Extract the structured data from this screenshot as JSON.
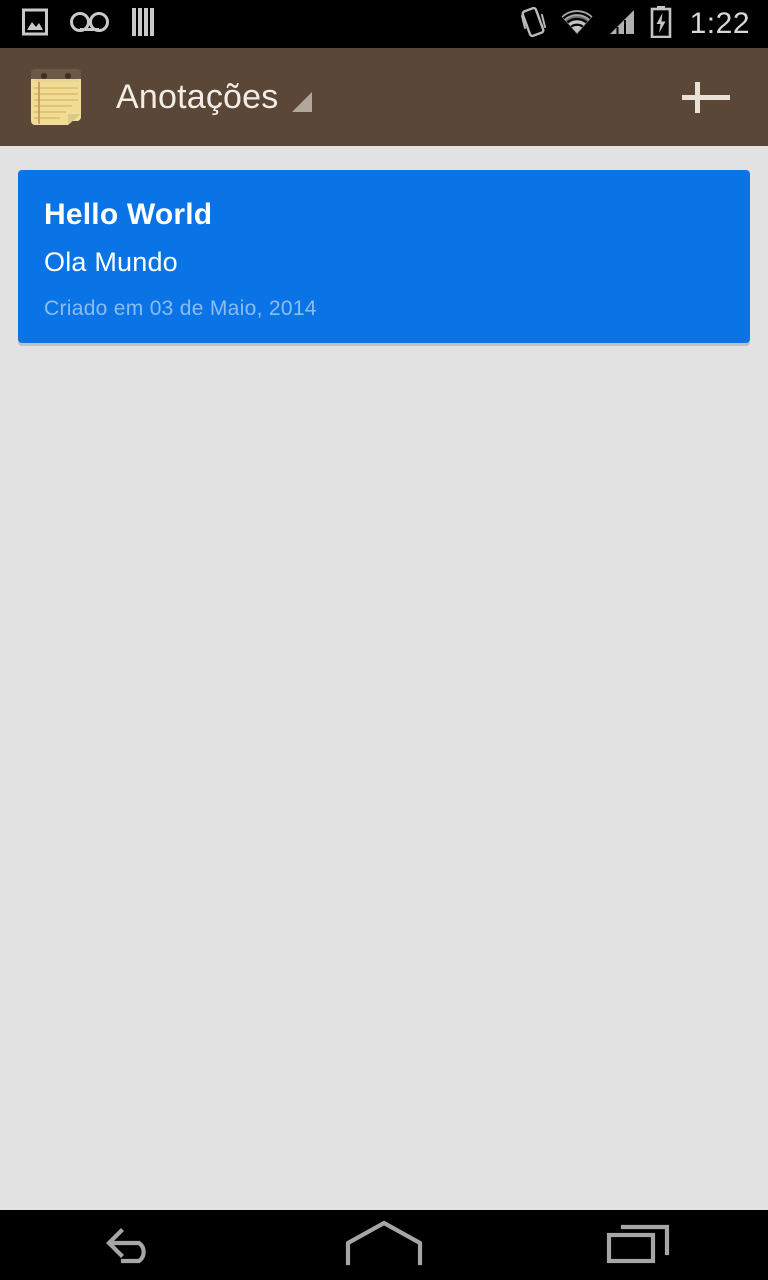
{
  "status_bar": {
    "background": "#000000",
    "foreground": "#d8d8d8",
    "clock": "1:22",
    "left_icons": [
      {
        "name": "image-icon",
        "label": "Screenshot captured"
      },
      {
        "name": "voicemail-icon",
        "label": "Voicemail"
      },
      {
        "name": "bars-icon",
        "label": "Notification bars"
      }
    ],
    "right_icons": [
      {
        "name": "vibrate-phone-icon",
        "label": "Vibrate"
      },
      {
        "name": "wifi-icon",
        "label": "Wi-Fi connected"
      },
      {
        "name": "cellular-signal-icon",
        "label": "Cellular signal"
      },
      {
        "name": "battery-charging-icon",
        "label": "Battery charging"
      }
    ]
  },
  "action_bar": {
    "background": "#5a4737",
    "title": "Anotações",
    "title_color": "#f3ede6",
    "app_icon": "notepad-icon",
    "spinner_caret": "dropdown-caret-icon",
    "add_button_label": "+",
    "add_button_name": "add-note-button"
  },
  "content": {
    "background": "#e2e2e2",
    "notes": [
      {
        "title": "Hello World",
        "body": "Ola Mundo",
        "date": "Criado em 03 de Maio, 2014",
        "color": "#0a74e6"
      }
    ]
  },
  "nav_bar": {
    "background": "#000000",
    "icon_color": "#a6a6a6",
    "buttons": [
      {
        "name": "nav-back-button",
        "label": "Back"
      },
      {
        "name": "nav-home-button",
        "label": "Home"
      },
      {
        "name": "nav-recents-button",
        "label": "Recent apps"
      }
    ]
  }
}
